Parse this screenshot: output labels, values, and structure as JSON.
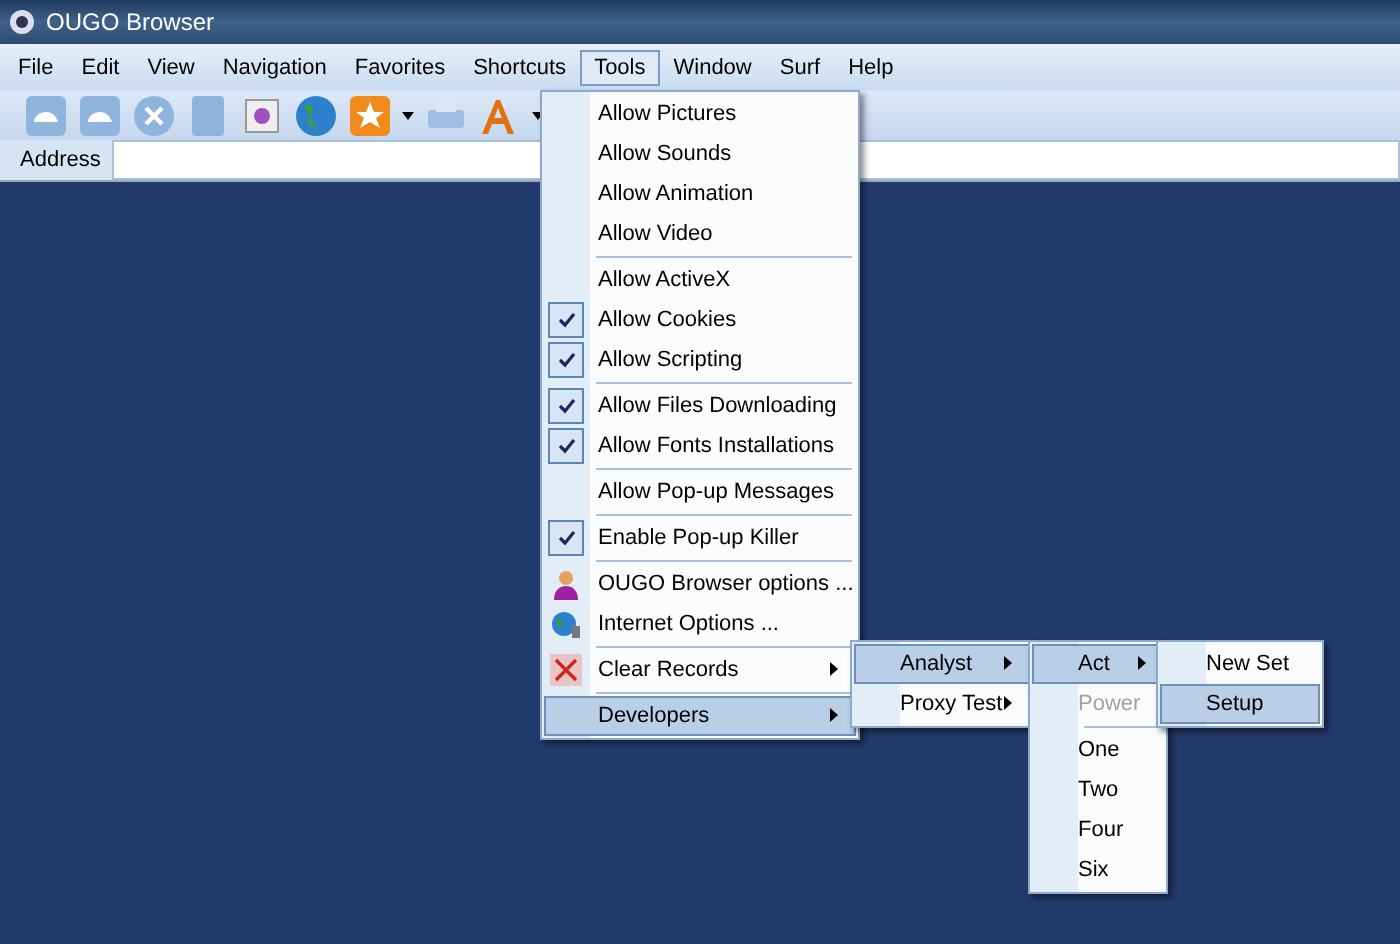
{
  "window": {
    "title": "OUGO Browser"
  },
  "menubar": [
    {
      "label": "File",
      "selected": false
    },
    {
      "label": "Edit",
      "selected": false
    },
    {
      "label": "View",
      "selected": false
    },
    {
      "label": "Navigation",
      "selected": false
    },
    {
      "label": "Favorites",
      "selected": false
    },
    {
      "label": "Shortcuts",
      "selected": false
    },
    {
      "label": "Tools",
      "selected": true
    },
    {
      "label": "Window",
      "selected": false
    },
    {
      "label": "Surf",
      "selected": false
    },
    {
      "label": "Help",
      "selected": false
    }
  ],
  "address_bar": {
    "label": "Address"
  },
  "tools_menu": {
    "groups": [
      [
        {
          "label": "Allow Pictures",
          "checked": false,
          "selected": false
        },
        {
          "label": "Allow Sounds",
          "checked": false,
          "selected": false
        },
        {
          "label": "Allow Animation",
          "checked": false,
          "selected": false
        },
        {
          "label": "Allow Video",
          "checked": false,
          "selected": false
        }
      ],
      [
        {
          "label": "Allow ActiveX",
          "checked": false,
          "selected": false
        },
        {
          "label": "Allow Cookies",
          "checked": true,
          "selected": false
        },
        {
          "label": "Allow Scripting",
          "checked": true,
          "selected": false
        }
      ],
      [
        {
          "label": "Allow Files Downloading",
          "checked": true,
          "selected": false
        },
        {
          "label": "Allow Fonts Installations",
          "checked": true,
          "selected": false
        }
      ],
      [
        {
          "label": "Allow Pop-up Messages",
          "checked": false,
          "selected": false
        }
      ],
      [
        {
          "label": "Enable Pop-up Killer",
          "checked": true,
          "selected": false
        }
      ],
      [
        {
          "label": "OUGO Browser options ...",
          "kind": "icon",
          "selected": false
        },
        {
          "label": "Internet Options ...",
          "kind": "icon",
          "selected": false
        }
      ],
      [
        {
          "label": "Clear Records",
          "kind": "icon",
          "submenu": true,
          "selected": false
        }
      ],
      [
        {
          "label": "Developers",
          "submenu": true,
          "selected": true
        }
      ]
    ]
  },
  "developers_menu": {
    "items": [
      {
        "label": "Analyst",
        "submenu": true,
        "selected": true
      },
      {
        "label": "Proxy Test",
        "submenu": true,
        "selected": false
      }
    ]
  },
  "analyst_menu": {
    "groups": [
      [
        {
          "label": "Act",
          "submenu": true,
          "selected": true
        },
        {
          "label": "Power",
          "disabled": true,
          "selected": false
        }
      ],
      [
        {
          "label": "One",
          "selected": false
        },
        {
          "label": "Two",
          "selected": false
        },
        {
          "label": "Four",
          "selected": false
        },
        {
          "label": "Six",
          "selected": false
        }
      ]
    ]
  },
  "act_menu": {
    "items": [
      {
        "label": "New Set",
        "selected": false
      },
      {
        "label": "Setup",
        "selected": true
      }
    ]
  }
}
